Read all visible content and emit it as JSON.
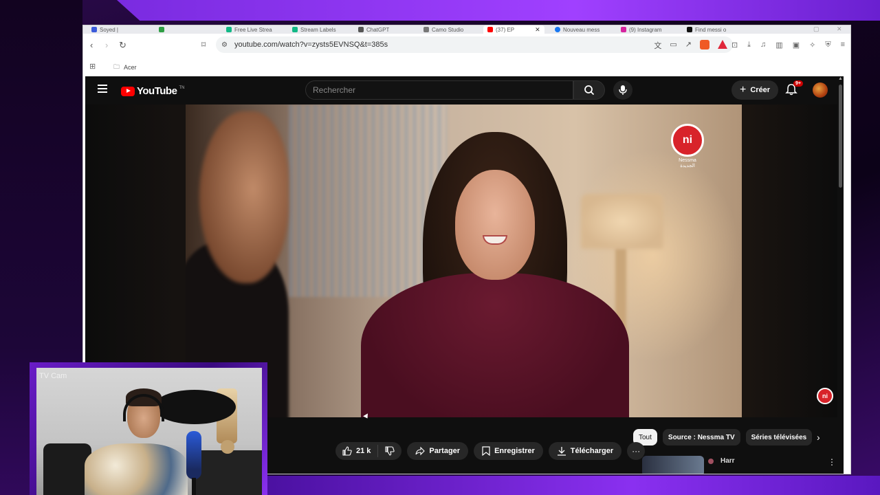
{
  "tabs": [
    {
      "label": "Soyed |",
      "color": "#3b5bdb"
    },
    {
      "label": "",
      "color": "#2f9e44"
    },
    {
      "label": "Free Live Strea",
      "color": "#12b886"
    },
    {
      "label": "Stream Labels",
      "color": "#12b886"
    },
    {
      "label": "ChatGPT",
      "color": "#555555"
    },
    {
      "label": "Camo Studio",
      "color": "#777777"
    },
    {
      "label": "(37) EP",
      "color": "#ff0000",
      "active": true,
      "close": "✕"
    },
    {
      "label": "Nouveau mess",
      "color": "#1877f2"
    },
    {
      "label": "(9) Instagram",
      "color": "#d6249f"
    },
    {
      "label": "Find messi o",
      "color": "#111111"
    }
  ],
  "address": {
    "url": "youtube.com/watch?v=zysts5EVNSQ&t=385s"
  },
  "bookmarks": {
    "folder": "Acer"
  },
  "youtube": {
    "logo_text": "YouTube",
    "logo_suffix": "TN",
    "search_placeholder": "Rechercher",
    "create_label": "Créer",
    "notifications": "9+"
  },
  "video": {
    "channel_watermark": "ni",
    "channel_watermark_text": "Nessma الجديدة"
  },
  "actions": {
    "likes": "21 k",
    "share": "Partager",
    "save": "Enregistrer",
    "download": "Télécharger",
    "more": "···"
  },
  "chips": [
    {
      "label": "Tout",
      "active": true
    },
    {
      "label": "Source : Nessma TV",
      "active": false
    },
    {
      "label": "Séries télévisées",
      "active": false
    }
  ],
  "recommendation": {
    "title": "Harr"
  },
  "webcam": {
    "label": "TV Cam"
  }
}
